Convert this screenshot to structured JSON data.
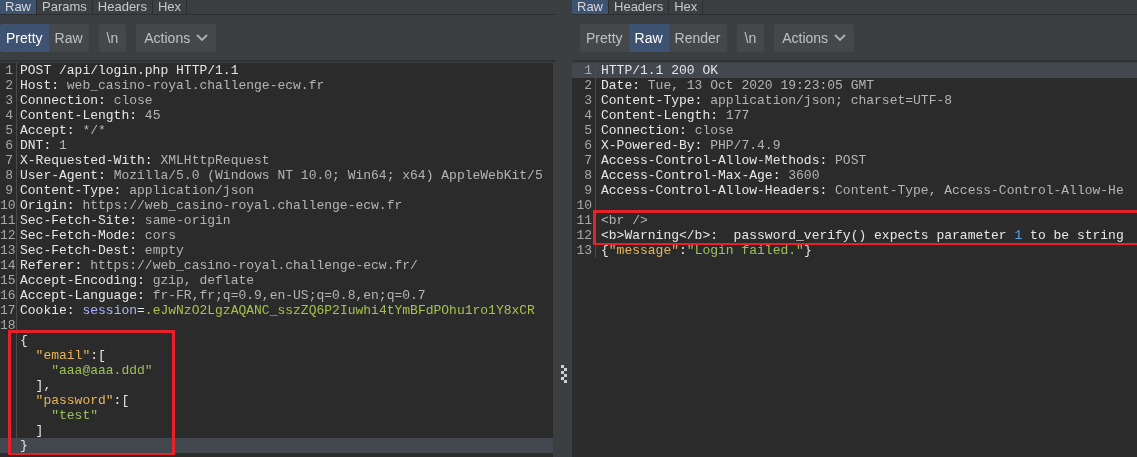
{
  "request": {
    "tabs": [
      {
        "label": "Raw",
        "selected": true
      },
      {
        "label": "Params",
        "selected": false
      },
      {
        "label": "Headers",
        "selected": false
      },
      {
        "label": "Hex",
        "selected": false
      }
    ],
    "view_modes": [
      {
        "label": "Pretty",
        "selected": true
      },
      {
        "label": "Raw",
        "selected": false
      }
    ],
    "newline_button": "\\n",
    "actions_button": "Actions",
    "lines": [
      {
        "number": "1",
        "current": false,
        "boxed": false,
        "segments": [
          {
            "kind": "plain",
            "text": "POST /api/login.php HTTP/1.1"
          }
        ]
      },
      {
        "number": "2",
        "current": false,
        "boxed": false,
        "segments": [
          {
            "kind": "plain",
            "text": "Host: "
          },
          {
            "kind": "value",
            "text": "web_casino-royal.challenge-ecw.fr"
          }
        ]
      },
      {
        "number": "3",
        "current": false,
        "boxed": false,
        "segments": [
          {
            "kind": "plain",
            "text": "Connection: "
          },
          {
            "kind": "value",
            "text": "close"
          }
        ]
      },
      {
        "number": "4",
        "current": false,
        "boxed": false,
        "segments": [
          {
            "kind": "plain",
            "text": "Content-Length: "
          },
          {
            "kind": "value",
            "text": "45"
          }
        ]
      },
      {
        "number": "5",
        "current": false,
        "boxed": false,
        "segments": [
          {
            "kind": "plain",
            "text": "Accept: "
          },
          {
            "kind": "value",
            "text": "*/*"
          }
        ]
      },
      {
        "number": "6",
        "current": false,
        "boxed": false,
        "segments": [
          {
            "kind": "plain",
            "text": "DNT: "
          },
          {
            "kind": "value",
            "text": "1"
          }
        ]
      },
      {
        "number": "7",
        "current": false,
        "boxed": false,
        "segments": [
          {
            "kind": "plain",
            "text": "X-Requested-With: "
          },
          {
            "kind": "value",
            "text": "XMLHttpRequest"
          }
        ]
      },
      {
        "number": "8",
        "current": false,
        "boxed": false,
        "segments": [
          {
            "kind": "plain",
            "text": "User-Agent: "
          },
          {
            "kind": "value",
            "text": "Mozilla/5.0 (Windows NT 10.0; Win64; x64) AppleWebKit/5"
          }
        ]
      },
      {
        "number": "9",
        "current": false,
        "boxed": false,
        "segments": [
          {
            "kind": "plain",
            "text": "Content-Type: "
          },
          {
            "kind": "value",
            "text": "application/json"
          }
        ]
      },
      {
        "number": "10",
        "current": false,
        "boxed": false,
        "segments": [
          {
            "kind": "plain",
            "text": "Origin: "
          },
          {
            "kind": "value",
            "text": "https://web_casino-royal.challenge-ecw.fr"
          }
        ]
      },
      {
        "number": "11",
        "current": false,
        "boxed": false,
        "segments": [
          {
            "kind": "plain",
            "text": "Sec-Fetch-Site: "
          },
          {
            "kind": "value",
            "text": "same-origin"
          }
        ]
      },
      {
        "number": "12",
        "current": false,
        "boxed": false,
        "segments": [
          {
            "kind": "plain",
            "text": "Sec-Fetch-Mode: "
          },
          {
            "kind": "value",
            "text": "cors"
          }
        ]
      },
      {
        "number": "13",
        "current": false,
        "boxed": false,
        "segments": [
          {
            "kind": "plain",
            "text": "Sec-Fetch-Dest: "
          },
          {
            "kind": "value",
            "text": "empty"
          }
        ]
      },
      {
        "number": "14",
        "current": false,
        "boxed": false,
        "segments": [
          {
            "kind": "plain",
            "text": "Referer: "
          },
          {
            "kind": "value",
            "text": "https://web_casino-royal.challenge-ecw.fr/"
          }
        ]
      },
      {
        "number": "15",
        "current": false,
        "boxed": false,
        "segments": [
          {
            "kind": "plain",
            "text": "Accept-Encoding: "
          },
          {
            "kind": "value",
            "text": "gzip, deflate"
          }
        ]
      },
      {
        "number": "16",
        "current": false,
        "boxed": false,
        "segments": [
          {
            "kind": "plain",
            "text": "Accept-Language: "
          },
          {
            "kind": "value",
            "text": "fr-FR,fr;q=0.9,en-US;q=0.8,en;q=0.7"
          }
        ]
      },
      {
        "number": "17",
        "current": false,
        "boxed": false,
        "segments": [
          {
            "kind": "plain",
            "text": "Cookie: "
          },
          {
            "kind": "param",
            "text": "session"
          },
          {
            "kind": "plain",
            "text": "="
          },
          {
            "kind": "token",
            "text": ".eJwNzO2LgzAQANC_sszZQ6P2Iuwhi4tYmBFdPOhu1ro1Y8xCR"
          }
        ]
      },
      {
        "number": "18",
        "current": false,
        "boxed": false
      },
      {
        "current": false,
        "boxed": true,
        "segments": [
          {
            "kind": "plain",
            "text": "{"
          }
        ],
        "children": [
          {
            "current": false,
            "segments": [
              {
                "kind": "key",
                "text": "\"email\""
              },
              {
                "kind": "plain",
                "text": ":["
              }
            ],
            "children": [
              {
                "current": false,
                "segments": [
                  {
                    "kind": "string",
                    "text": "\"aaa@aaa.ddd\""
                  }
                ]
              }
            ]
          },
          {
            "current": false,
            "segments": [
              {
                "kind": "plain",
                "text": "],"
              }
            ]
          },
          {
            "current": false,
            "segments": [
              {
                "kind": "key",
                "text": "\"password\""
              },
              {
                "kind": "plain",
                "text": ":["
              }
            ],
            "children": [
              {
                "current": false,
                "segments": [
                  {
                    "kind": "string",
                    "text": "\"test\""
                  }
                ]
              }
            ]
          },
          {
            "current": false,
            "segments": [
              {
                "kind": "plain",
                "text": "]"
              }
            ]
          }
        ]
      },
      {
        "current": true,
        "boxed": true,
        "segments": [
          {
            "kind": "plain",
            "text": "}"
          }
        ]
      }
    ]
  },
  "response": {
    "tabs": [
      {
        "label": "Raw",
        "selected": true
      },
      {
        "label": "Headers",
        "selected": false
      },
      {
        "label": "Hex",
        "selected": false
      }
    ],
    "view_modes": [
      {
        "label": "Pretty",
        "selected": false
      },
      {
        "label": "Raw",
        "selected": true
      },
      {
        "label": "Render",
        "selected": false
      }
    ],
    "newline_button": "\\n",
    "actions_button": "Actions",
    "lines": [
      {
        "number": "1",
        "current": true,
        "boxed": false,
        "segments": [
          {
            "kind": "plain",
            "text": "HTTP/1.1 200 OK"
          }
        ]
      },
      {
        "number": "2",
        "current": false,
        "boxed": false,
        "segments": [
          {
            "kind": "plain",
            "text": "Date: "
          },
          {
            "kind": "value",
            "text": "Tue, 13 Oct 2020 19:23:05 GMT"
          }
        ]
      },
      {
        "number": "3",
        "current": false,
        "boxed": false,
        "segments": [
          {
            "kind": "plain",
            "text": "Content-Type: "
          },
          {
            "kind": "value",
            "text": "application/json; charset=UTF-8"
          }
        ]
      },
      {
        "number": "4",
        "current": false,
        "boxed": false,
        "segments": [
          {
            "kind": "plain",
            "text": "Content-Length: "
          },
          {
            "kind": "value",
            "text": "177"
          }
        ]
      },
      {
        "number": "5",
        "current": false,
        "boxed": false,
        "segments": [
          {
            "kind": "plain",
            "text": "Connection: "
          },
          {
            "kind": "value",
            "text": "close"
          }
        ]
      },
      {
        "number": "6",
        "current": false,
        "boxed": false,
        "segments": [
          {
            "kind": "plain",
            "text": "X-Powered-By: "
          },
          {
            "kind": "value",
            "text": "PHP/7.4.9"
          }
        ]
      },
      {
        "number": "7",
        "current": false,
        "boxed": false,
        "segments": [
          {
            "kind": "plain",
            "text": "Access-Control-Allow-Methods: "
          },
          {
            "kind": "value",
            "text": "POST"
          }
        ]
      },
      {
        "number": "8",
        "current": false,
        "boxed": false,
        "segments": [
          {
            "kind": "plain",
            "text": "Access-Control-Max-Age: "
          },
          {
            "kind": "value",
            "text": "3600"
          }
        ]
      },
      {
        "number": "9",
        "current": false,
        "boxed": false,
        "segments": [
          {
            "kind": "plain",
            "text": "Access-Control-Allow-Headers: "
          },
          {
            "kind": "value",
            "text": "Content-Type, Access-Control-Allow-He"
          }
        ]
      },
      {
        "number": "10",
        "current": false,
        "boxed": false
      },
      {
        "number": "11",
        "current": false,
        "boxed": true,
        "segments": [
          {
            "kind": "value",
            "text": "<br />"
          }
        ]
      },
      {
        "number": "12",
        "current": false,
        "boxed": true,
        "segments": [
          {
            "kind": "plain",
            "text": "<b>Warning</b>:  password_verify() expects parameter "
          },
          {
            "kind": "number",
            "text": "1"
          },
          {
            "kind": "plain",
            "text": " to be string"
          }
        ]
      },
      {
        "number": "13",
        "current": false,
        "boxed": false,
        "segments": [
          {
            "kind": "plain",
            "text": "{"
          },
          {
            "kind": "key",
            "text": "\"message\""
          },
          {
            "kind": "plain",
            "text": ":"
          },
          {
            "kind": "string",
            "text": "\"Login failed.\""
          },
          {
            "kind": "plain",
            "text": "}"
          }
        ]
      }
    ]
  }
}
